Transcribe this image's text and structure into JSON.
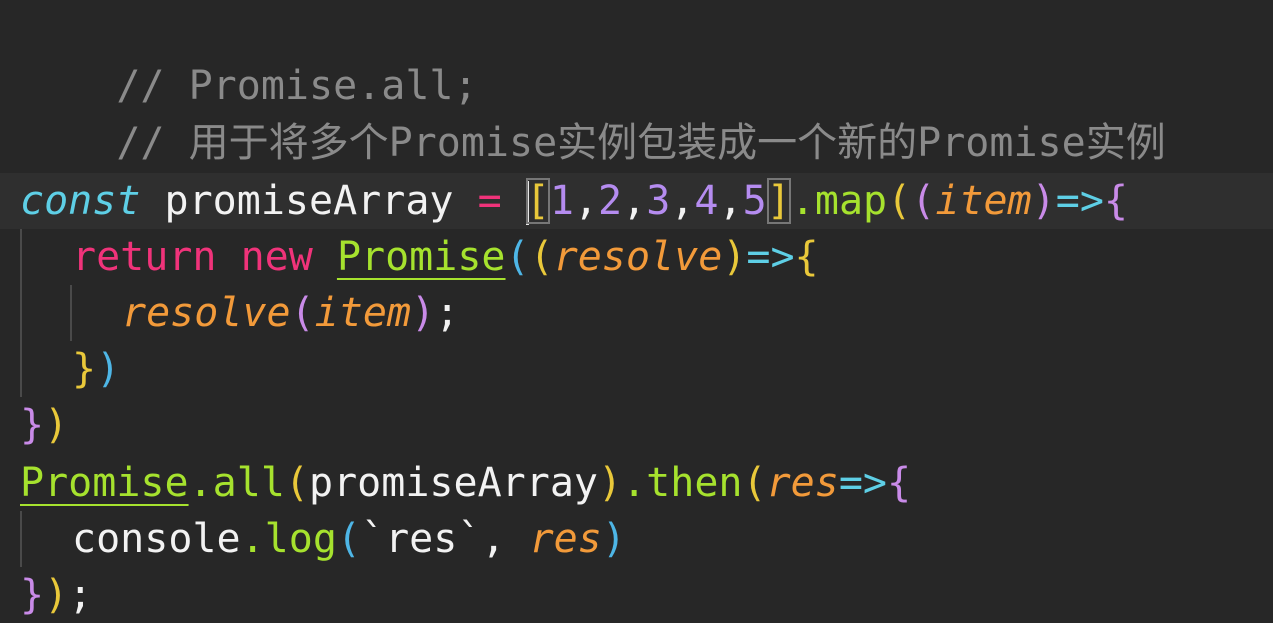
{
  "editor": {
    "comment_line_1": "// Promise.all;",
    "comment_line_2": "// 用于将多个Promise实例包装成一个新的Promise实例",
    "line_const": {
      "kw_const": "const",
      "var_name": " promiseArray ",
      "assign": "=",
      "space": " ",
      "bracket_open": "[",
      "n1": "1",
      "c1": ",",
      "n2": "2",
      "c2": ",",
      "n3": "3",
      "c3": ",",
      "n4": "4",
      "c4": ",",
      "n5": "5",
      "bracket_close": "]",
      "dot_map": ".map",
      "paren_open": "(",
      "param_paren_open": "(",
      "param_item": "item",
      "param_paren_close": ")",
      "arrow": "=>",
      "brace_open": "{"
    },
    "line_return": {
      "kw_return": "return",
      "kw_new": "new",
      "class_promise": "Promise",
      "paren_open": "(",
      "param_paren_open": "(",
      "param_resolve": "resolve",
      "param_paren_close": ")",
      "arrow": "=>",
      "brace_open": "{"
    },
    "line_resolve": {
      "fn_resolve": "resolve",
      "paren_open": "(",
      "arg_item": "item",
      "paren_close": ")",
      "semicolon": ";"
    },
    "line_inner_close": {
      "brace_close": "}",
      "paren_close": ")"
    },
    "line_outer_close": {
      "brace_close": "}",
      "paren_close": ")"
    },
    "line_promise_all": {
      "class_promise": "Promise",
      "dot_all": ".all",
      "paren_open": "(",
      "arg": "promiseArray",
      "paren_close": ")",
      "dot_then": ".then",
      "paren_open_2": "(",
      "param_res": "res",
      "arrow": "=>",
      "brace_open": "{"
    },
    "line_console": {
      "obj_console": "console",
      "dot_log": ".log",
      "paren_open": "(",
      "string": "`res`",
      "comma": ", ",
      "arg_res": "res",
      "paren_close": ")"
    },
    "line_final_close": {
      "brace_close": "}",
      "paren_close": ")",
      "semicolon": ";"
    }
  }
}
